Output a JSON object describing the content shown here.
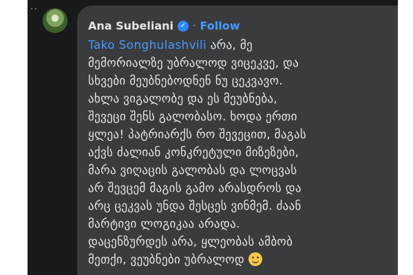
{
  "comment": {
    "author": "Ana Subeliani",
    "separator": "·",
    "follow_label": "Follow",
    "verified_icon": "verified-check-icon",
    "mention": "Tako Songhulashvili",
    "lines": [
      " არა, მე",
      "მემორიალზე უბრალოდ ვიცეკვე, და",
      "სხვები მეუბნებოდნენ ნუ ცეკვავო.",
      "ახლა ვიგალობე და ეს მეუბნება,",
      "შევეცი შენს გალობასო. ხოდა ერთი",
      "ყლეა! პატრიარქს რო შევეცით, მაგას",
      "აქვს ძალიან კონკრეტული მიზეზები,",
      "მარა ვიღაცის გალობას და ლოცვას",
      "არ შევცემ მაგის გამო არასდროს და",
      "არც ცეკვას უნდა შესცეს ვინმემ. ძაან",
      "მარტივი ლოგიკაა არადა.",
      "დაცენზურდეს არა, ყლეობას ამბობ",
      "მეთქი, ვეუბნები უბრალოდ"
    ],
    "emoji": "slightly-smiling-face"
  },
  "colors": {
    "background": "#18191a",
    "bubble": "#3a3b3c",
    "text": "#e4e6eb",
    "link": "#4599ff",
    "verified": "#2d88ff"
  }
}
